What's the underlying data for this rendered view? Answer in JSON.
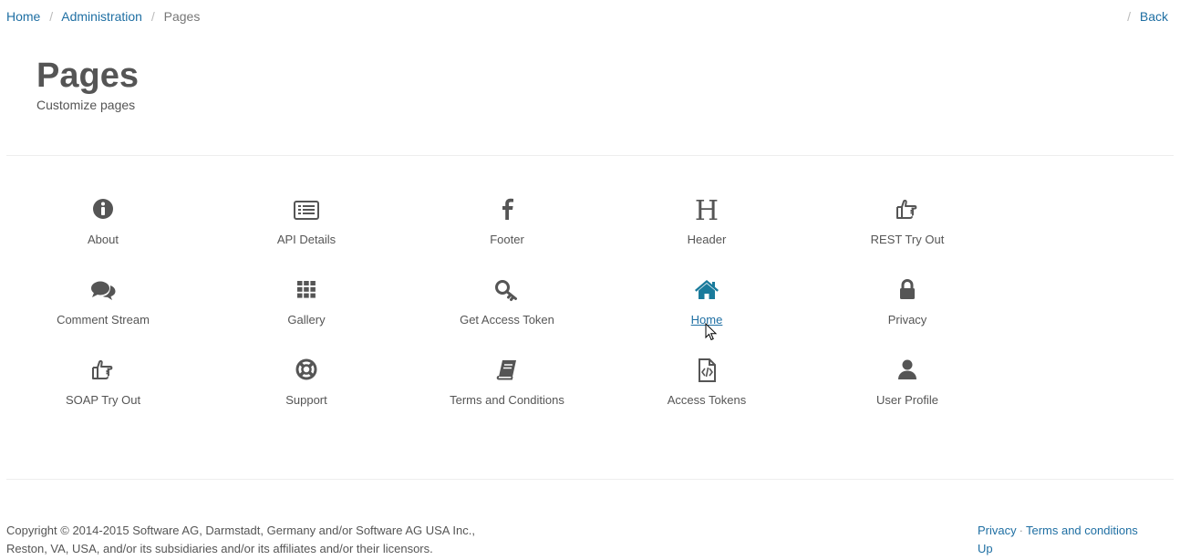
{
  "breadcrumb": {
    "items": [
      "Home",
      "Administration"
    ],
    "current": "Pages",
    "separator": "/"
  },
  "back": {
    "label": "Back",
    "separator": "/"
  },
  "header": {
    "title": "Pages",
    "subtitle": "Customize pages"
  },
  "tiles": [
    {
      "label": "About",
      "icon": "info-circle-icon"
    },
    {
      "label": "API Details",
      "icon": "list-alt-icon"
    },
    {
      "label": "Footer",
      "icon": "facebook-f-icon"
    },
    {
      "label": "Header",
      "icon": "header-h-icon"
    },
    {
      "label": "REST Try Out",
      "icon": "hand-pointer-icon"
    },
    {
      "label": "Comment Stream",
      "icon": "comments-icon"
    },
    {
      "label": "Gallery",
      "icon": "grid-icon"
    },
    {
      "label": "Get Access Token",
      "icon": "key-icon"
    },
    {
      "label": "Home",
      "icon": "home-icon",
      "active": true
    },
    {
      "label": "Privacy",
      "icon": "lock-icon"
    },
    {
      "label": "SOAP Try Out",
      "icon": "hand-pointer-icon"
    },
    {
      "label": "Support",
      "icon": "life-ring-icon"
    },
    {
      "label": "Terms and Conditions",
      "icon": "book-icon"
    },
    {
      "label": "Access Tokens",
      "icon": "file-code-icon"
    },
    {
      "label": "User Profile",
      "icon": "user-icon"
    }
  ],
  "footer": {
    "copyright_line1": "Copyright © 2014-2015 Software AG, Darmstadt, Germany and/or Software AG USA Inc.,",
    "copyright_line2": "Reston, VA, USA, and/or its subsidiaries and/or its affiliates and/or their licensors.",
    "links": [
      "Privacy",
      "Terms and conditions"
    ],
    "link_separator": "·",
    "up_label": "Up"
  },
  "colors": {
    "link": "#1f6fa3",
    "text": "#555555",
    "icon": "#555555",
    "active_icon": "#1a7b9c"
  }
}
